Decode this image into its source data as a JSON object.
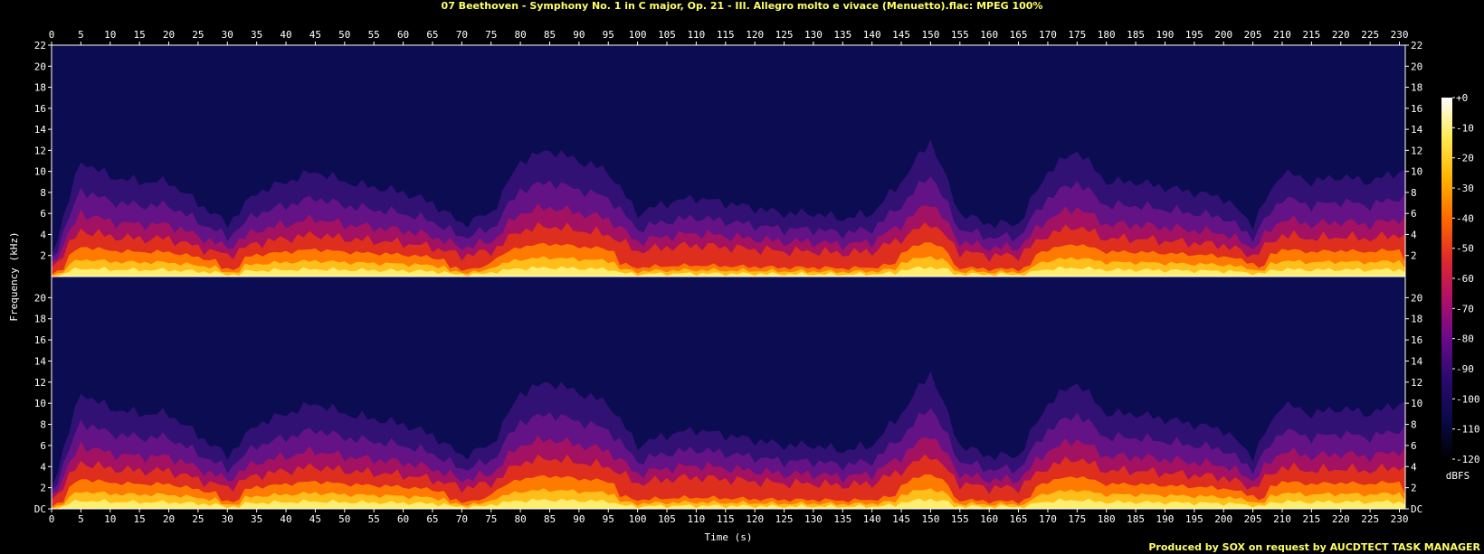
{
  "window": {
    "title": "07 Beethoven - Symphony No. 1 in C major, Op. 21 - III. Allegro molto e vivace (Menuetto).flac: MPEG 100%",
    "footer": "Produced by SOX on request by AUCDTECT TASK MANAGER"
  },
  "chart_data": {
    "type": "heatmap",
    "title": "07 Beethoven - Symphony No. 1 in C major, Op. 21 - III. Allegro molto e vivace (Menuetto).flac: MPEG 100%",
    "xlabel": "Time (s)",
    "ylabel": "Frequency (kHz)",
    "xlim": [
      0,
      231
    ],
    "ylim": [
      0,
      22
    ],
    "x_ticks": [
      "0",
      "5",
      "10",
      "15",
      "20",
      "25",
      "30",
      "35",
      "40",
      "45",
      "50",
      "55",
      "60",
      "65",
      "70",
      "75",
      "80",
      "85",
      "90",
      "95",
      "100",
      "105",
      "110",
      "115",
      "120",
      "125",
      "130",
      "135",
      "140",
      "145",
      "150",
      "155",
      "160",
      "165",
      "170",
      "175",
      "180",
      "185",
      "190",
      "195",
      "200",
      "205",
      "210",
      "215",
      "220",
      "225",
      "230"
    ],
    "y_ticks": [
      "DC",
      "2",
      "4",
      "6",
      "8",
      "10",
      "12",
      "14",
      "16",
      "18",
      "20",
      "22"
    ],
    "channels": 2,
    "colorbar": {
      "label": "dBFS",
      "ticks": [
        "+0",
        "-10",
        "-20",
        "-30",
        "-40",
        "-50",
        "-60",
        "-70",
        "-80",
        "-90",
        "-100",
        "-110",
        "-120"
      ],
      "range": [
        -120,
        0
      ],
      "colors": [
        "#000000",
        "#0a0a4a",
        "#2a0a6e",
        "#6a0a8a",
        "#b0106a",
        "#e02a2a",
        "#ff6a00",
        "#ffb400",
        "#ffea50",
        "#ffffff"
      ]
    },
    "loud_sections_s": [
      [
        3,
        8
      ],
      [
        8,
        28
      ],
      [
        33,
        55
      ],
      [
        55,
        67
      ],
      [
        75,
        96
      ],
      [
        145,
        153
      ],
      [
        168,
        178
      ],
      [
        178,
        205
      ],
      [
        208,
        230
      ]
    ],
    "quiet_sections_s": [
      [
        96,
        145
      ],
      [
        153,
        168
      ]
    ],
    "energy_profile": {
      "time_s": [
        0,
        5,
        10,
        15,
        20,
        25,
        30,
        35,
        40,
        45,
        50,
        55,
        60,
        65,
        70,
        75,
        80,
        85,
        90,
        95,
        100,
        105,
        110,
        115,
        120,
        125,
        130,
        135,
        140,
        145,
        150,
        155,
        160,
        165,
        170,
        175,
        180,
        185,
        190,
        195,
        200,
        205,
        210,
        215,
        220,
        225,
        230
      ],
      "upper_extent_khz": [
        2,
        11,
        9.5,
        9,
        9,
        7,
        5,
        8,
        9,
        10,
        9,
        8.5,
        8,
        7,
        5,
        6,
        11,
        12,
        11,
        10,
        6,
        7,
        7.5,
        7,
        6.5,
        6,
        6,
        5.5,
        6,
        9,
        13,
        6,
        5,
        5,
        10,
        12,
        9,
        9,
        8.5,
        8,
        7.5,
        5,
        10,
        9,
        9.5,
        9,
        10
      ]
    }
  }
}
